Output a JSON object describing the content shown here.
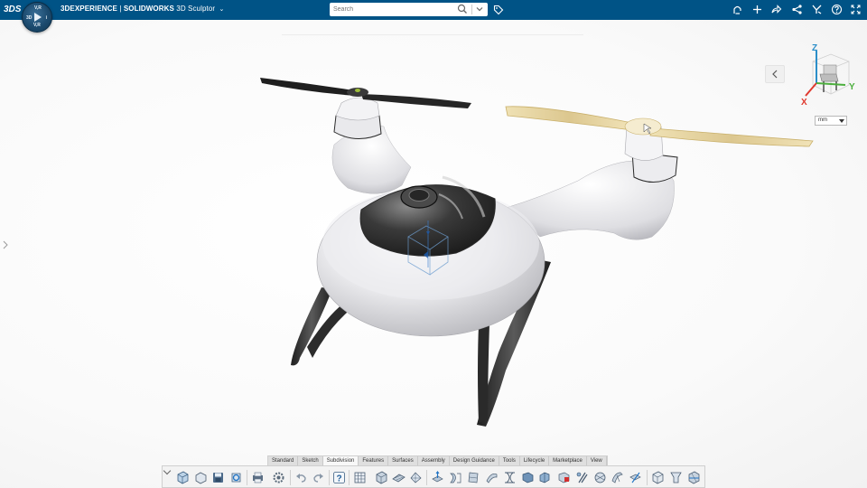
{
  "header": {
    "logo": "3DS",
    "brand_prefix": "3DEXPERIENCE",
    "brand_sep": " | ",
    "brand_product": "SOLIDWORKS",
    "app_name": "3D Sculptor",
    "compass": {
      "top": "V,R",
      "left": "3D",
      "right": "i",
      "bottom": "V,R"
    }
  },
  "search": {
    "placeholder": "Search",
    "value": ""
  },
  "top_icons": [
    "user-icon",
    "add-icon",
    "share-icon",
    "network-share-icon",
    "tools-icon",
    "help-icon",
    "fullscreen-icon"
  ],
  "viewport": {
    "unit_select": "mm",
    "axes": {
      "x": "X",
      "y": "Y",
      "z": "Z"
    },
    "colors": {
      "propeller_selected": "#e6d39f",
      "body": "#e8e8eb",
      "dark_parts": "#2b2b2b",
      "axis_x": "#e03a2f",
      "axis_y": "#4caf3d",
      "axis_z": "#2b8ec9"
    }
  },
  "action_bar": {
    "tabs": [
      "Standard",
      "Sketch",
      "Subdivision",
      "Features",
      "Surfaces",
      "Assembly",
      "Design Guidance",
      "Tools",
      "Lifecycle",
      "Marketplace",
      "View"
    ],
    "active_tab": "Subdivision"
  }
}
